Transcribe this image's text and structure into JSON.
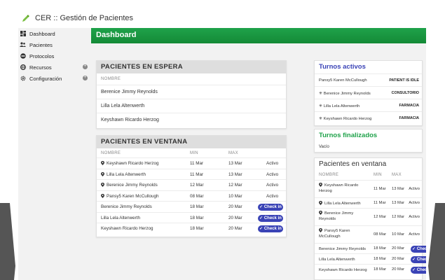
{
  "app": {
    "title": "CER :: Gestión de Pacientes"
  },
  "sidebar": {
    "items": [
      {
        "label": "Dashboard",
        "icon": "dashboard-icon",
        "expandable": false
      },
      {
        "label": "Pacientes",
        "icon": "users-icon",
        "expandable": false
      },
      {
        "label": "Protocolos",
        "icon": "protocol-icon",
        "expandable": false
      },
      {
        "label": "Recursos",
        "icon": "globe-icon",
        "expandable": true
      },
      {
        "label": "Configuración",
        "icon": "gear-icon",
        "expandable": true
      }
    ]
  },
  "header": {
    "title": "Dashboard"
  },
  "espera": {
    "title": "PACIENTES EN ESPERA",
    "column": "NOMBRE",
    "rows": [
      "Berenice Jimmy Reynolds",
      "Lilla Lela Altenwerth",
      "Keyshawn Ricardo Herzog"
    ]
  },
  "ventana": {
    "title": "PACIENTES EN VENTANA",
    "columns": {
      "name": "NOMBRE",
      "min": "MIN",
      "max": "MAX"
    },
    "rows": [
      {
        "name": "Keyshawn Ricardo Herzog",
        "min": "11 Mar",
        "max": "13 Mar",
        "status": "Activo",
        "pin": true
      },
      {
        "name": "Lilla Lela Altenwerth",
        "min": "11 Mar",
        "max": "13 Mar",
        "status": "Activo",
        "pin": true
      },
      {
        "name": "Berenice Jimmy Reynolds",
        "min": "12 Mar",
        "max": "12 Mar",
        "status": "Activo",
        "pin": true
      },
      {
        "name": "Pansy5 Karen McCullough",
        "min": "08 Mar",
        "max": "10 Mar",
        "status": "Activo",
        "pin": true
      },
      {
        "name": "Berenice Jimmy Reynolds",
        "min": "18 Mar",
        "max": "20 Mar",
        "action": "Check in",
        "pin": false
      },
      {
        "name": "Lilla Lela Altenwerth",
        "min": "18 Mar",
        "max": "20 Mar",
        "action": "Check in",
        "pin": false
      },
      {
        "name": "Keyshawn Ricardo Herzog",
        "min": "18 Mar",
        "max": "20 Mar",
        "action": "Check in",
        "pin": false
      }
    ]
  },
  "turnos_activos": {
    "title": "Turnos activos",
    "rows": [
      {
        "name": "Pansy5 Karen McCullough",
        "badge": "PATIENT IS IDLE",
        "icon": false
      },
      {
        "name": "Berenice Jimmy Reynolds",
        "badge": "CONSULTORIO",
        "icon": true
      },
      {
        "name": "Lilla Lela Altenwerth",
        "badge": "FARMACIA",
        "icon": true
      },
      {
        "name": "Keyshawn Ricardo Herzog",
        "badge": "FARMACIA",
        "icon": true
      }
    ]
  },
  "turnos_finalizados": {
    "title": "Turnos finalizados",
    "empty": "Vacío"
  },
  "ventana2": {
    "title": "Pacientes en ventana",
    "columns": {
      "name": "NOMBRE",
      "min": "MIN",
      "max": "MAX"
    },
    "rows": [
      {
        "name": "Keyshawn Ricardo Herzog",
        "min": "11 Mar",
        "max": "13 Mar",
        "status": "Activo",
        "pin": true
      },
      {
        "name": "Lilla Lela Altenwerth",
        "min": "11 Mar",
        "max": "13 Mar",
        "status": "Activo",
        "pin": true
      },
      {
        "name": "Berenice Jimmy Reynolds",
        "min": "12 Mar",
        "max": "12 Mar",
        "status": "Activo",
        "pin": true
      },
      {
        "name": "Pansy5 Karen McCullough",
        "min": "08 Mar",
        "max": "10 Mar",
        "status": "Activo",
        "pin": true
      },
      {
        "name": "Berenice Jimmy Reynolds",
        "min": "18 Mar",
        "max": "20 Mar",
        "action": "Check in",
        "pin": false
      },
      {
        "name": "Lilla Lela Altenwerth",
        "min": "18 Mar",
        "max": "20 Mar",
        "action": "Check in",
        "pin": false
      },
      {
        "name": "Keyshawn Ricardo Herzog",
        "min": "18 Mar",
        "max": "20 Mar",
        "action": "Check in",
        "pin": false
      }
    ]
  },
  "colors": {
    "green": "#1fa24a",
    "button": "#3a43b6",
    "active_title": "#3a43b6",
    "finished_title": "#1fa24a"
  }
}
